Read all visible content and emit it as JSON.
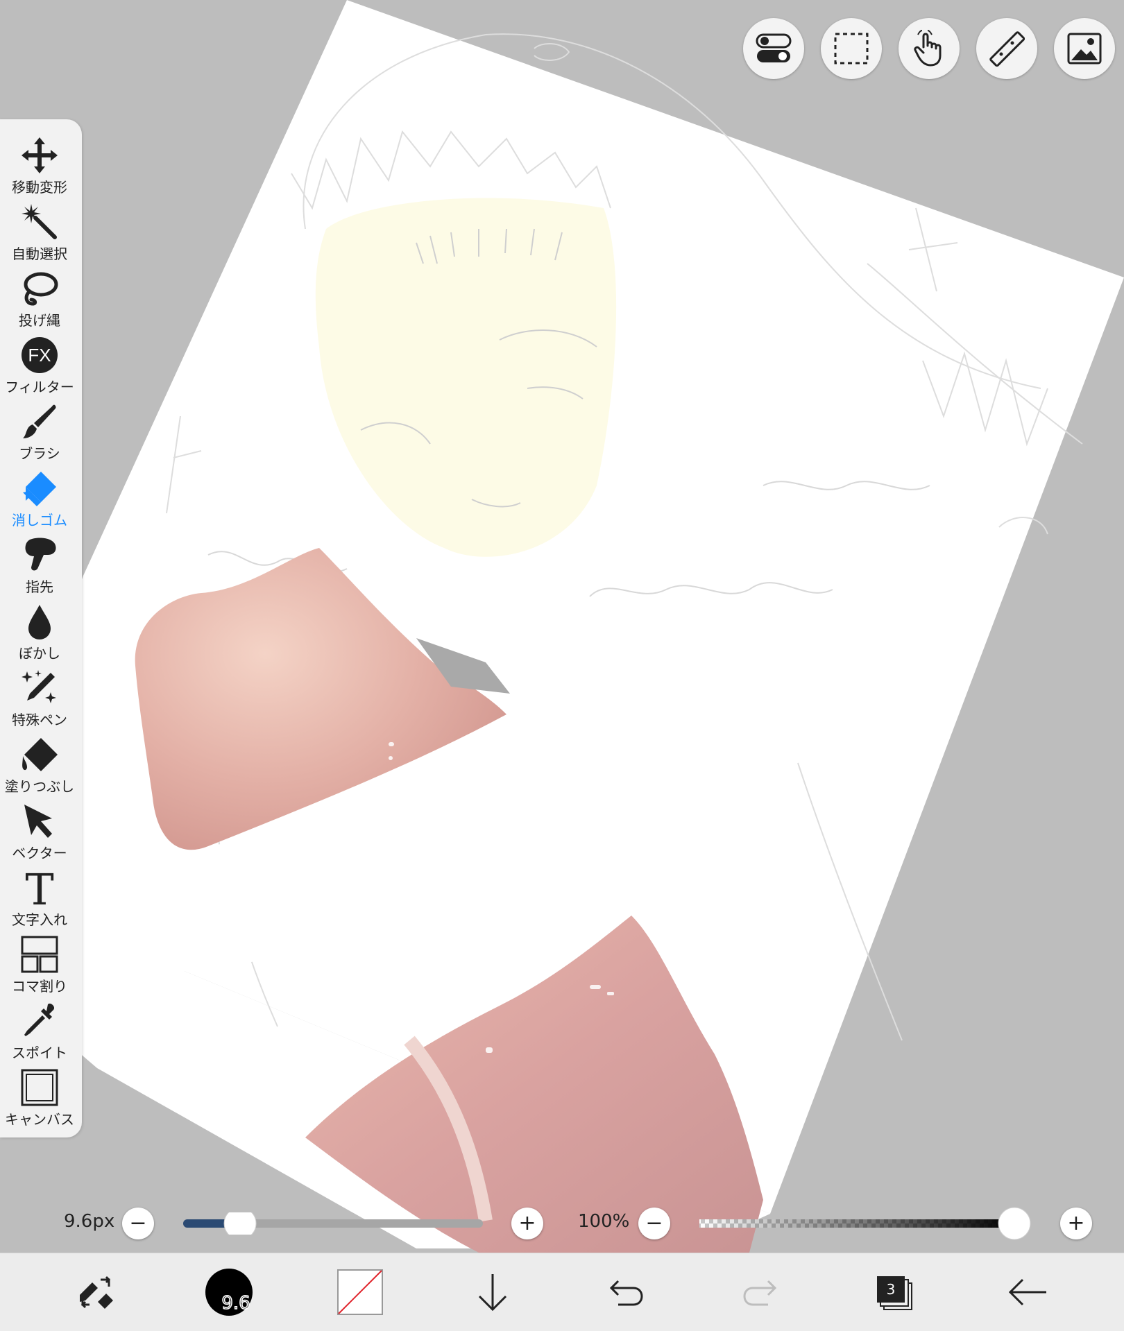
{
  "colors": {
    "accent": "#1a8cff",
    "workspace": "#bdbdbd",
    "panel": "#f2f2f2",
    "skin": "#e8b4ab",
    "hair": "#fdfbe6",
    "slider_fill": "#2b4a73"
  },
  "top_toolbar": {
    "icons": [
      "toggle-icon",
      "selection-rect-icon",
      "hand-gesture-icon",
      "ruler-icon",
      "image-icon"
    ]
  },
  "tools": [
    {
      "label": "移動変形",
      "icon": "move-icon"
    },
    {
      "label": "自動選択",
      "icon": "magic-wand-icon"
    },
    {
      "label": "投げ縄",
      "icon": "lasso-icon"
    },
    {
      "label": "フィルター",
      "icon": "fx-icon",
      "fx_text": "FX"
    },
    {
      "label": "ブラシ",
      "icon": "brush-icon"
    },
    {
      "label": "消しゴム",
      "icon": "eraser-icon",
      "active": true
    },
    {
      "label": "指先",
      "icon": "finger-icon"
    },
    {
      "label": "ぼかし",
      "icon": "blur-drop-icon"
    },
    {
      "label": "特殊ペン",
      "icon": "special-pen-icon"
    },
    {
      "label": "塗りつぶし",
      "icon": "fill-bucket-icon"
    },
    {
      "label": "ベクター",
      "icon": "vector-cursor-icon"
    },
    {
      "label": "文字入れ",
      "icon": "text-icon",
      "glyph": "T"
    },
    {
      "label": "コマ割り",
      "icon": "panel-frame-icon"
    },
    {
      "label": "スポイト",
      "icon": "eyedropper-icon"
    },
    {
      "label": "キャンバス",
      "icon": "canvas-icon"
    }
  ],
  "brush": {
    "size_label": "9.6px",
    "size_fraction": 0.19,
    "opacity_label": "100%",
    "opacity_fraction": 1.0,
    "minus": "−",
    "plus": "+"
  },
  "bottom_bar": {
    "brush_size_badge": "9.6",
    "layer_count": "3",
    "icons": [
      "swap-tool-icon",
      "brush-color-icon",
      "secondary-color-icon",
      "download-arrow-icon",
      "undo-icon",
      "redo-icon",
      "layers-icon",
      "back-arrow-icon"
    ]
  }
}
